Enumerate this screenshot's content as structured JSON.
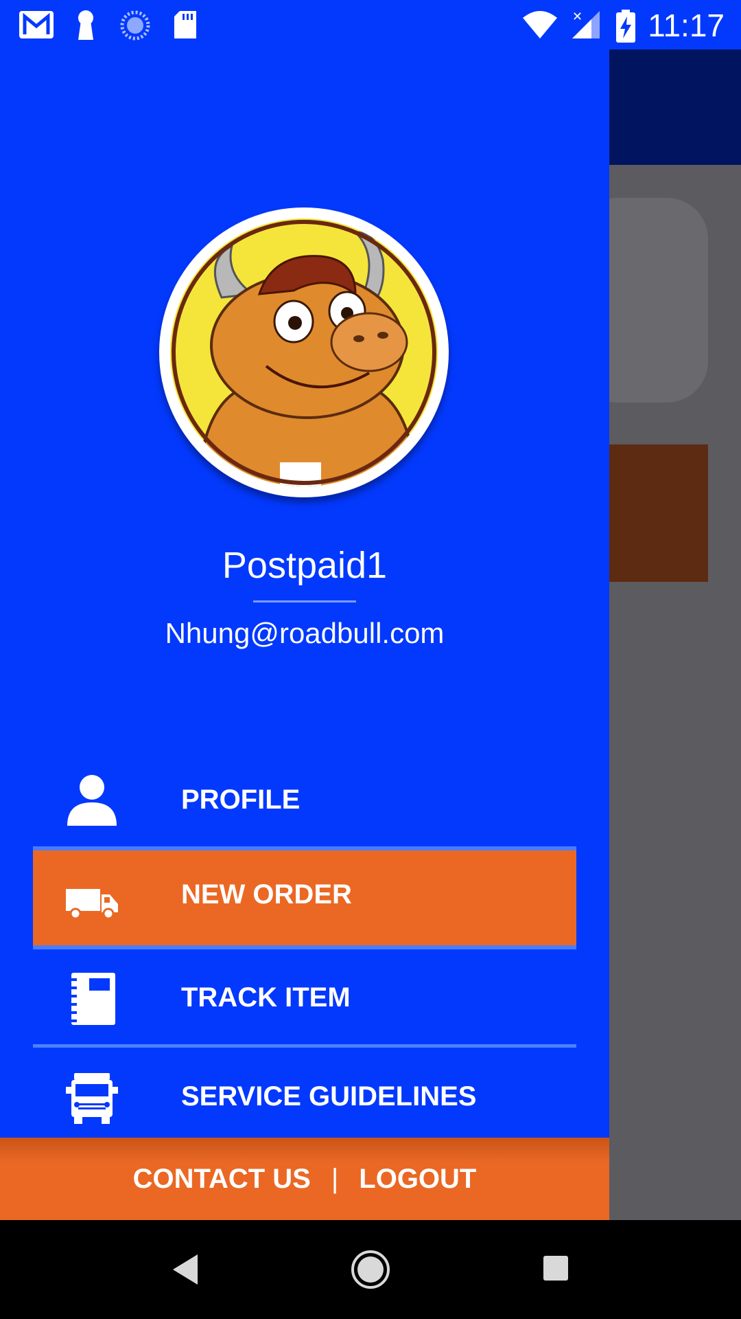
{
  "status_bar": {
    "time": "11:17",
    "left_icons": [
      "gmail-icon",
      "keyhole-icon",
      "sync-icon",
      "sd-card-icon"
    ],
    "right_icons": [
      "wifi-icon",
      "signal-icon",
      "battery-charging-icon"
    ]
  },
  "drawer": {
    "user": {
      "name": "Postpaid1",
      "email": "Nhung@roadbull.com"
    },
    "menu": [
      {
        "label": "PROFILE",
        "icon": "person-icon",
        "active": false
      },
      {
        "label": "NEW ORDER",
        "icon": "delivery-van-icon",
        "active": true
      },
      {
        "label": "TRACK ITEM",
        "icon": "notebook-icon",
        "active": false
      },
      {
        "label": "SERVICE GUIDELINES",
        "icon": "truck-front-icon",
        "active": false
      }
    ],
    "footer": {
      "contact_label": "CONTACT US",
      "separator": "|",
      "logout_label": "LOGOUT"
    }
  },
  "colors": {
    "drawer_blue": "#0339fd",
    "accent_orange": "#ea6824",
    "toolbar_dark": "#01145f"
  },
  "nav_bar": {
    "buttons": [
      "back-icon",
      "home-icon",
      "recents-icon"
    ]
  }
}
